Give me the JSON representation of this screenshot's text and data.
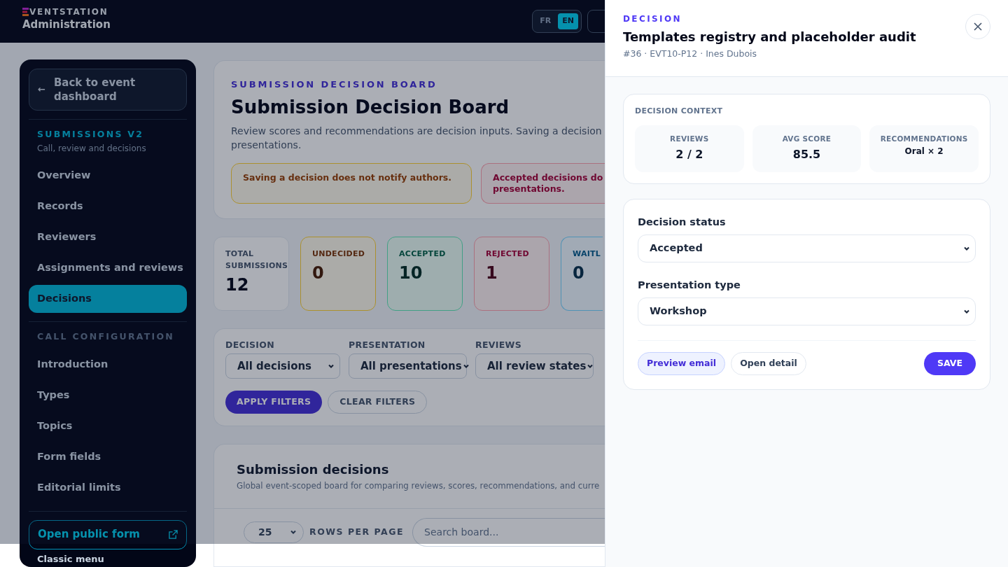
{
  "header": {
    "brand": "VENTSTATION",
    "title": "Administration",
    "languages": [
      {
        "label": "FR",
        "selected": false
      },
      {
        "label": "EN",
        "selected": true
      }
    ]
  },
  "sidebar": {
    "back_icon": "←",
    "back_link": "Back to event dashboard",
    "sections": [
      {
        "title": "SUBMISSIONS V2",
        "subtitle": "Call, review and decisions",
        "items": [
          {
            "label": "Overview",
            "selected": false
          },
          {
            "label": "Records",
            "selected": false
          },
          {
            "label": "Reviewers",
            "selected": false
          },
          {
            "label": "Assignments and reviews",
            "selected": false
          },
          {
            "label": "Decisions",
            "selected": true
          }
        ]
      },
      {
        "title": "CALL CONFIGURATION",
        "items": [
          {
            "label": "Introduction",
            "selected": false
          },
          {
            "label": "Types",
            "selected": false
          },
          {
            "label": "Topics",
            "selected": false
          },
          {
            "label": "Form fields",
            "selected": false
          },
          {
            "label": "Editorial limits",
            "selected": false
          }
        ]
      }
    ],
    "public_form": "Open public form",
    "classic_menu": "Classic menu"
  },
  "page_header": {
    "eyebrow": "SUBMISSION DECISION BOARD",
    "title": "Submission Decision Board",
    "description_lines": [
      "Review scores and recommendations are decision inputs. Saving a decision",
      "presentations."
    ],
    "notices": [
      {
        "kind": "warning",
        "lines": [
          "Saving a decision does not notify authors."
        ]
      },
      {
        "kind": "danger",
        "lines": [
          "Accepted decisions do",
          "presentations."
        ]
      }
    ]
  },
  "stats": [
    {
      "kind": "neutral",
      "label": "TOTAL SUBMISSIONS",
      "value": "12"
    },
    {
      "kind": "undecided",
      "label": "UNDECIDED",
      "value": "0"
    },
    {
      "kind": "accepted",
      "label": "ACCEPTED",
      "value": "10"
    },
    {
      "kind": "rejected",
      "label": "REJECTED",
      "value": "1"
    },
    {
      "kind": "waitlist",
      "label": "WAITL",
      "value": "0"
    }
  ],
  "filters": {
    "fields": [
      {
        "label": "DECISION",
        "value": "All decisions"
      },
      {
        "label": "PRESENTATION",
        "value": "All presentations"
      },
      {
        "label": "REVIEWS",
        "value": "All review states"
      }
    ],
    "buttons": [
      {
        "kind": "primary",
        "label": "APPLY FILTERS"
      },
      {
        "kind": "secondary",
        "label": "CLEAR FILTERS"
      }
    ]
  },
  "decisions_table": {
    "title": "Submission decisions",
    "description": "Global event-scoped board for comparing reviews, scores, recommendations, and curre",
    "rows_per_page": "25",
    "rows_per_page_label": "ROWS PER PAGE",
    "search_placeholder": "Search board..."
  },
  "drawer": {
    "eyebrow": "DECISION",
    "title": "Templates registry and placeholder audit",
    "meta": "#36 · EVT10-P12 · Ines Dubois",
    "context_title": "DECISION CONTEXT",
    "metrics": [
      {
        "kind": "large",
        "label": "REVIEWS",
        "value": "2 / 2"
      },
      {
        "kind": "large",
        "label": "AVG SCORE",
        "value": "85.5"
      },
      {
        "kind": "small",
        "label": "RECOMMENDATIONS",
        "value": "Oral × 2"
      }
    ],
    "fields": [
      {
        "label": "Decision status",
        "value": "Accepted"
      },
      {
        "label": "Presentation type",
        "value": "Workshop"
      }
    ],
    "actions": [
      {
        "kind": "soft",
        "label": "Preview email"
      },
      {
        "kind": "outline",
        "label": "Open detail"
      },
      {
        "kind": "primary",
        "label": "SAVE"
      }
    ]
  }
}
